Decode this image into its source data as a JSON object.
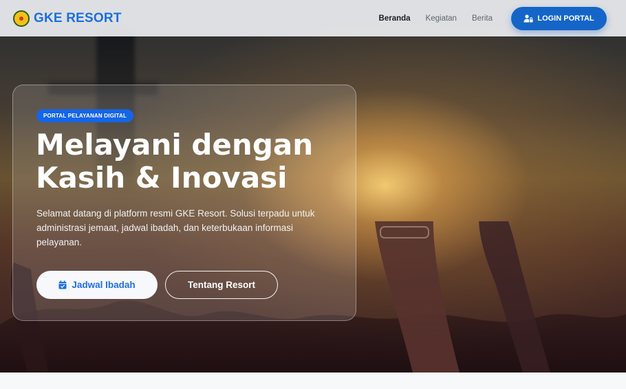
{
  "navbar": {
    "brand_name": "GKE RESORT",
    "links": [
      {
        "label": "Beranda",
        "active": true
      },
      {
        "label": "Kegiatan",
        "active": false
      },
      {
        "label": "Berita",
        "active": false
      }
    ],
    "login_label": "LOGIN PORTAL",
    "login_icon": "user-lock-icon"
  },
  "hero": {
    "badge": "PORTAL PELAYANAN DIGITAL",
    "headline_line1": "Melayani dengan",
    "headline_line2": "Kasih & Inovasi",
    "description": "Selamat datang di platform resmi GKE Resort. Solusi terpadu untuk administrasi jemaat, jadwal ibadah, dan keterbukaan informasi pelayanan.",
    "primary_button": "Jadwal Ibadah",
    "primary_icon": "calendar-check-icon",
    "secondary_button": "Tentang Resort"
  },
  "colors": {
    "brand": "#1b6fe0",
    "login_button": "#1565c8",
    "badge": "#1565e8"
  }
}
